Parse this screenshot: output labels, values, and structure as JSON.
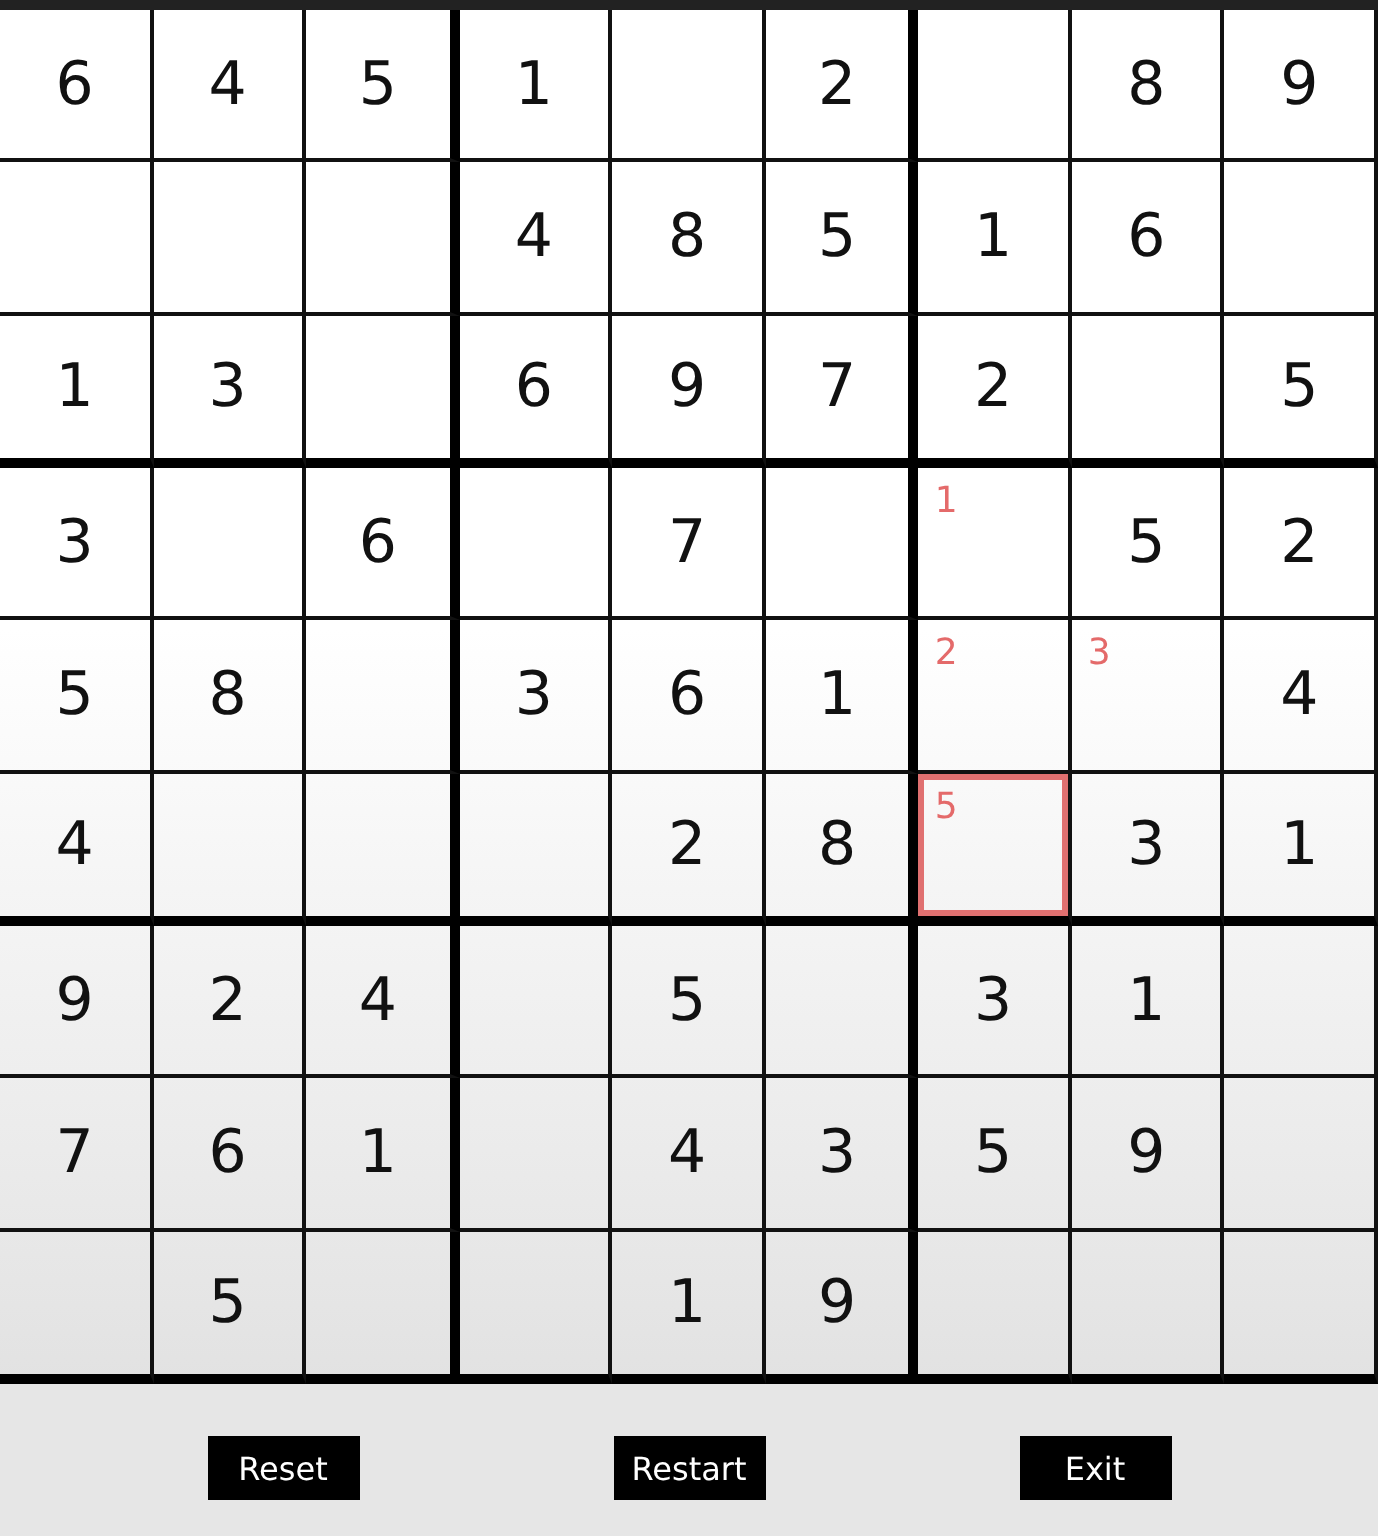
{
  "grid": {
    "rows": [
      [
        {
          "kind": "given",
          "value": "6",
          "selected": false
        },
        {
          "kind": "given",
          "value": "4",
          "selected": false
        },
        {
          "kind": "given",
          "value": "5",
          "selected": false
        },
        {
          "kind": "given",
          "value": "1",
          "selected": false
        },
        {
          "kind": "empty",
          "selected": false
        },
        {
          "kind": "given",
          "value": "2",
          "selected": false
        },
        {
          "kind": "empty",
          "selected": false
        },
        {
          "kind": "given",
          "value": "8",
          "selected": false
        },
        {
          "kind": "given",
          "value": "9",
          "selected": false
        }
      ],
      [
        {
          "kind": "empty",
          "selected": false
        },
        {
          "kind": "empty",
          "selected": false
        },
        {
          "kind": "empty",
          "selected": false
        },
        {
          "kind": "given",
          "value": "4",
          "selected": false
        },
        {
          "kind": "given",
          "value": "8",
          "selected": false
        },
        {
          "kind": "given",
          "value": "5",
          "selected": false
        },
        {
          "kind": "given",
          "value": "1",
          "selected": false
        },
        {
          "kind": "given",
          "value": "6",
          "selected": false
        },
        {
          "kind": "empty",
          "selected": false
        }
      ],
      [
        {
          "kind": "given",
          "value": "1",
          "selected": false
        },
        {
          "kind": "given",
          "value": "3",
          "selected": false
        },
        {
          "kind": "empty",
          "selected": false
        },
        {
          "kind": "given",
          "value": "6",
          "selected": false
        },
        {
          "kind": "given",
          "value": "9",
          "selected": false
        },
        {
          "kind": "given",
          "value": "7",
          "selected": false
        },
        {
          "kind": "given",
          "value": "2",
          "selected": false
        },
        {
          "kind": "empty",
          "selected": false
        },
        {
          "kind": "given",
          "value": "5",
          "selected": false
        }
      ],
      [
        {
          "kind": "given",
          "value": "3",
          "selected": false
        },
        {
          "kind": "empty",
          "selected": false
        },
        {
          "kind": "given",
          "value": "6",
          "selected": false
        },
        {
          "kind": "empty",
          "selected": false
        },
        {
          "kind": "given",
          "value": "7",
          "selected": false
        },
        {
          "kind": "empty",
          "selected": false
        },
        {
          "kind": "note",
          "value": "1",
          "selected": false
        },
        {
          "kind": "given",
          "value": "5",
          "selected": false
        },
        {
          "kind": "given",
          "value": "2",
          "selected": false
        }
      ],
      [
        {
          "kind": "given",
          "value": "5",
          "selected": false
        },
        {
          "kind": "given",
          "value": "8",
          "selected": false
        },
        {
          "kind": "empty",
          "selected": false
        },
        {
          "kind": "given",
          "value": "3",
          "selected": false
        },
        {
          "kind": "given",
          "value": "6",
          "selected": false
        },
        {
          "kind": "given",
          "value": "1",
          "selected": false
        },
        {
          "kind": "note",
          "value": "2",
          "selected": false
        },
        {
          "kind": "note",
          "value": "3",
          "selected": false
        },
        {
          "kind": "given",
          "value": "4",
          "selected": false
        }
      ],
      [
        {
          "kind": "given",
          "value": "4",
          "selected": false
        },
        {
          "kind": "empty",
          "selected": false
        },
        {
          "kind": "empty",
          "selected": false
        },
        {
          "kind": "empty",
          "selected": false
        },
        {
          "kind": "given",
          "value": "2",
          "selected": false
        },
        {
          "kind": "given",
          "value": "8",
          "selected": false
        },
        {
          "kind": "note",
          "value": "5",
          "selected": true
        },
        {
          "kind": "given",
          "value": "3",
          "selected": false
        },
        {
          "kind": "given",
          "value": "1",
          "selected": false
        }
      ],
      [
        {
          "kind": "given",
          "value": "9",
          "selected": false
        },
        {
          "kind": "given",
          "value": "2",
          "selected": false
        },
        {
          "kind": "given",
          "value": "4",
          "selected": false
        },
        {
          "kind": "empty",
          "selected": false
        },
        {
          "kind": "given",
          "value": "5",
          "selected": false
        },
        {
          "kind": "empty",
          "selected": false
        },
        {
          "kind": "given",
          "value": "3",
          "selected": false
        },
        {
          "kind": "given",
          "value": "1",
          "selected": false
        },
        {
          "kind": "empty",
          "selected": false
        }
      ],
      [
        {
          "kind": "given",
          "value": "7",
          "selected": false
        },
        {
          "kind": "given",
          "value": "6",
          "selected": false
        },
        {
          "kind": "given",
          "value": "1",
          "selected": false
        },
        {
          "kind": "empty",
          "selected": false
        },
        {
          "kind": "given",
          "value": "4",
          "selected": false
        },
        {
          "kind": "given",
          "value": "3",
          "selected": false
        },
        {
          "kind": "given",
          "value": "5",
          "selected": false
        },
        {
          "kind": "given",
          "value": "9",
          "selected": false
        },
        {
          "kind": "empty",
          "selected": false
        }
      ],
      [
        {
          "kind": "empty",
          "selected": false
        },
        {
          "kind": "given",
          "value": "5",
          "selected": false
        },
        {
          "kind": "empty",
          "selected": false
        },
        {
          "kind": "empty",
          "selected": false
        },
        {
          "kind": "given",
          "value": "1",
          "selected": false
        },
        {
          "kind": "given",
          "value": "9",
          "selected": false
        },
        {
          "kind": "empty",
          "selected": false
        },
        {
          "kind": "empty",
          "selected": false
        },
        {
          "kind": "empty",
          "selected": false
        }
      ]
    ]
  },
  "buttons": [
    "Reset",
    "Restart",
    "Exit"
  ]
}
